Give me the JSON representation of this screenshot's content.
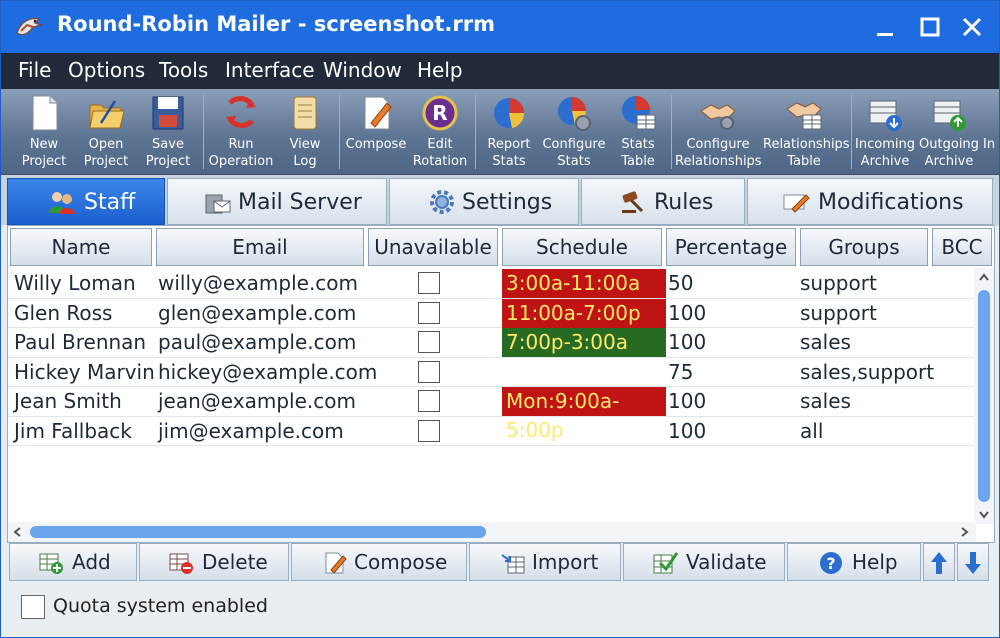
{
  "window": {
    "title": "Round-Robin Mailer - screenshot.rrm"
  },
  "menu": [
    "File",
    "Options",
    "Tools",
    "Interface",
    "Window",
    "Help"
  ],
  "toolbar": [
    {
      "l1": "New",
      "l2": "Project",
      "icon": "new-project-icon"
    },
    {
      "l1": "Open",
      "l2": "Project",
      "icon": "open-project-icon"
    },
    {
      "l1": "Save",
      "l2": "Project",
      "icon": "save-project-icon"
    },
    {
      "l1": "Run",
      "l2": "Operation",
      "icon": "run-operation-icon"
    },
    {
      "l1": "View",
      "l2": "Log",
      "icon": "view-log-icon"
    },
    {
      "l1": "Compose",
      "l2": "",
      "icon": "compose-icon"
    },
    {
      "l1": "Edit",
      "l2": "Rotation",
      "icon": "edit-rotation-icon"
    },
    {
      "l1": "Report",
      "l2": "Stats",
      "icon": "report-stats-icon"
    },
    {
      "l1": "Configure",
      "l2": "Stats",
      "icon": "configure-stats-icon"
    },
    {
      "l1": "Stats",
      "l2": "Table",
      "icon": "stats-table-icon"
    },
    {
      "l1": "Configure",
      "l2": "Relationships",
      "icon": "configure-relationships-icon"
    },
    {
      "l1": "Relationships",
      "l2": "Table",
      "icon": "relationships-table-icon"
    },
    {
      "l1": "Incoming",
      "l2": "Archive",
      "icon": "incoming-archive-icon"
    },
    {
      "l1": "Outgoing",
      "l2": "Archive",
      "icon": "outgoing-archive-icon"
    },
    {
      "l1": "In",
      "l2": "",
      "icon": "more-icon"
    }
  ],
  "tabs": [
    "Staff",
    "Mail Server",
    "Settings",
    "Rules",
    "Modifications"
  ],
  "columns": [
    "Name",
    "Email",
    "Unavailable",
    "Schedule",
    "Percentage",
    "Groups",
    "BCC"
  ],
  "rows": [
    {
      "name": "Willy Loman",
      "email": "willy@example.com",
      "unavailable": false,
      "schedule": "3:00a-11:00a",
      "schedule_color": "#c01414",
      "percentage": "50",
      "groups": "support"
    },
    {
      "name": "Glen Ross",
      "email": "glen@example.com",
      "unavailable": false,
      "schedule": "11:00a-7:00p",
      "schedule_color": "#c01414",
      "percentage": "100",
      "groups": "support"
    },
    {
      "name": "Paul Brennan",
      "email": "paul@example.com",
      "unavailable": false,
      "schedule": "7:00p-3:00a",
      "schedule_color": "#276b22",
      "percentage": "100",
      "groups": "sales"
    },
    {
      "name": "Hickey Marvin",
      "email": "hickey@example.com",
      "unavailable": false,
      "schedule": "",
      "schedule_color": "",
      "percentage": "75",
      "groups": "sales,support"
    },
    {
      "name": "Jean Smith",
      "email": "jean@example.com",
      "unavailable": false,
      "schedule": "Mon:9:00a-5:00p",
      "schedule_color": "#c01414",
      "percentage": "100",
      "groups": "sales"
    },
    {
      "name": "Jim Fallback",
      "email": "jim@example.com",
      "unavailable": false,
      "schedule": "",
      "schedule_color": "",
      "percentage": "100",
      "groups": "all"
    }
  ],
  "buttons": [
    "Add",
    "Delete",
    "Compose",
    "Import",
    "Validate",
    "Help"
  ],
  "footer": {
    "quota_label": "Quota system enabled",
    "quota_checked": false
  },
  "colors": {
    "titlebar": "#1f6ce0",
    "menubar": "#202a38",
    "active_tab": "#1d5fd0"
  }
}
